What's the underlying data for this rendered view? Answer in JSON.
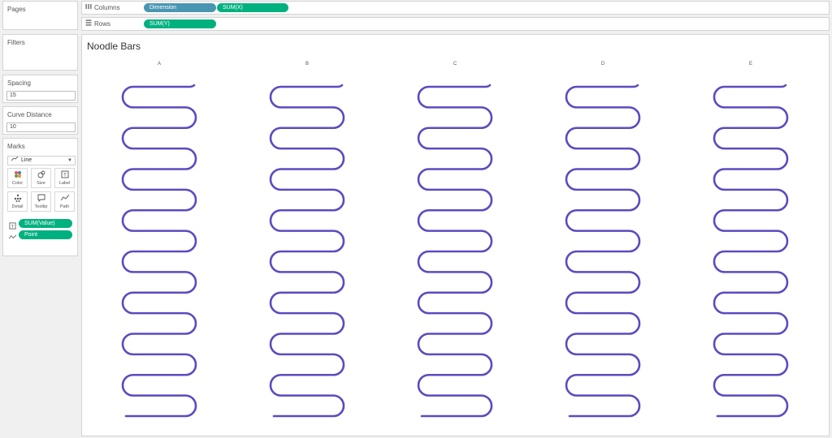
{
  "sidebar": {
    "pages": {
      "title": "Pages"
    },
    "filters": {
      "title": "Filters"
    },
    "spacing": {
      "title": "Spacing",
      "value": "15"
    },
    "curve_distance": {
      "title": "Curve Distance",
      "value": "10"
    },
    "marks": {
      "title": "Marks",
      "mark_type": "Line",
      "buttons": [
        {
          "label": "Color",
          "icon": "color-dots-icon"
        },
        {
          "label": "Size",
          "icon": "size-icon"
        },
        {
          "label": "Label",
          "icon": "label-icon"
        },
        {
          "label": "Detail",
          "icon": "detail-icon"
        },
        {
          "label": "Tooltip",
          "icon": "tooltip-icon"
        },
        {
          "label": "Path",
          "icon": "path-icon"
        }
      ],
      "fields": [
        {
          "label": "SUM(Value)",
          "icon": "label-icon"
        },
        {
          "label": "Point",
          "icon": "path-icon"
        }
      ]
    }
  },
  "shelves": {
    "columns": {
      "label": "Columns",
      "pills": [
        "Dimension",
        "SUM(X)"
      ]
    },
    "rows": {
      "label": "Rows",
      "pills": [
        "SUM(Y)"
      ]
    }
  },
  "viz": {
    "title": "Noodle Bars",
    "line_color": "#5b4bbf"
  },
  "chart_data": {
    "type": "line",
    "categories": [
      "A",
      "B",
      "C",
      "D",
      "E"
    ],
    "loops_per_bar": 8
  }
}
